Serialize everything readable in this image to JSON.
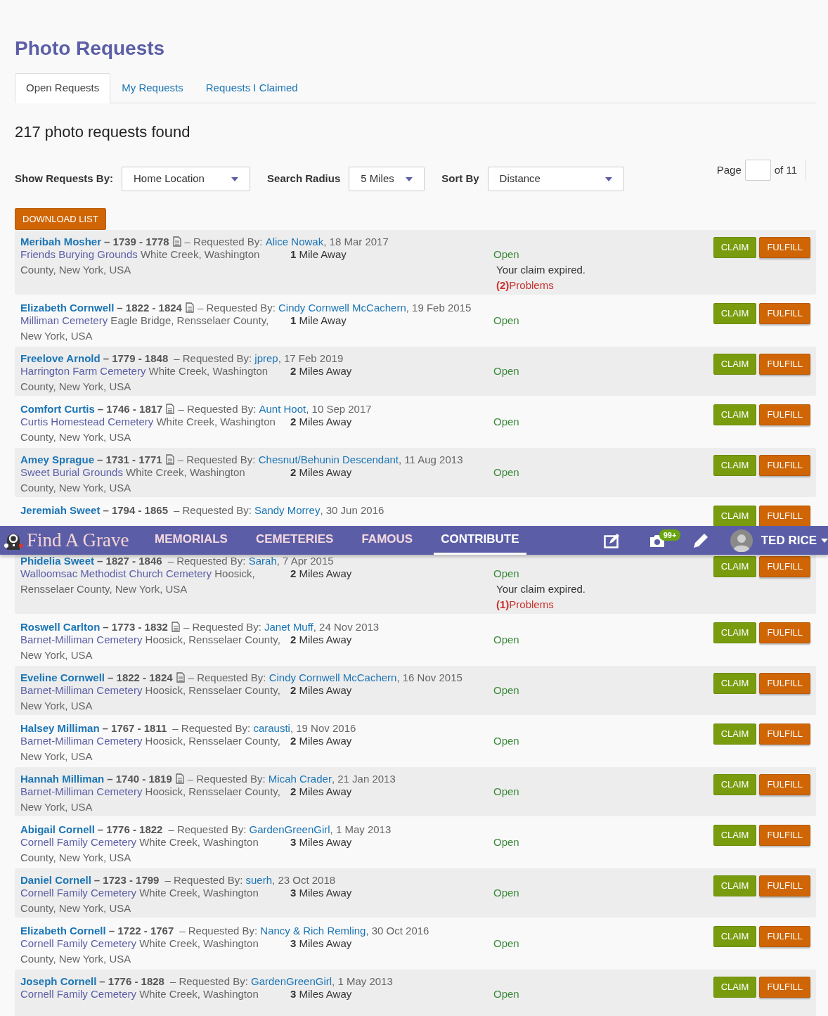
{
  "title": "Photo Requests",
  "tabs": [
    {
      "label": "Open Requests",
      "selected": true
    },
    {
      "label": "My Requests",
      "selected": false
    },
    {
      "label": "Requests I Claimed",
      "selected": false
    }
  ],
  "found": "217 photo requests found",
  "filters": [
    {
      "label": "Show Requests By:",
      "value": "Home Location"
    },
    {
      "label": "Search Radius",
      "value": "5 Miles"
    },
    {
      "label": "Sort By",
      "value": "Distance"
    }
  ],
  "pager": {
    "label": "Page",
    "total": "of 11"
  },
  "download": "DOWNLOAD LIST",
  "requests": [
    {
      "name": "Meribah Mosher",
      "years": "– 1739 - 1778",
      "note": true,
      "by": "– Requested By: ",
      "requester": "Alice Nowak",
      "date": ", 18 Mar 2017",
      "cemetery": "Friends Burying Grounds",
      "place": " White Creek, Washington County, New York, USA",
      "distance": "**1** Mile Away",
      "status": "Open",
      "expired": "Your claim expired.",
      "problems": "**(2)**Problems",
      "claim": "CLAIM",
      "fulfill": "FULFILL"
    },
    {
      "name": "Elizabeth Cornwell",
      "years": "– 1822 - 1824",
      "note": true,
      "by": "– Requested By: ",
      "requester": "Cindy Cornwell McCachern",
      "date": ", 19 Feb 2015",
      "cemetery": "Milliman Cemetery",
      "place": " Eagle Bridge, Rensselaer County, New York, USA",
      "distance": "**1** Mile Away",
      "status": "Open",
      "claim": "CLAIM",
      "fulfill": "FULFILL"
    },
    {
      "name": "Freelove Arnold",
      "years": "– 1779 - 1848",
      "note": false,
      "by": "– Requested By: ",
      "requester": "jprep",
      "date": ", 17 Feb 2019",
      "cemetery": "Harrington Farm Cemetery",
      "place": " White Creek, Washington County, New York, USA",
      "distance": "**2** Miles Away",
      "status": "Open",
      "claim": "CLAIM",
      "fulfill": "FULFILL"
    },
    {
      "name": "Comfort Curtis",
      "years": "– 1746 - 1817",
      "note": true,
      "by": "– Requested By: ",
      "requester": "Aunt Hoot",
      "date": ", 10 Sep 2017",
      "cemetery": "Curtis Homestead Cemetery",
      "place": " White Creek, Washington County, New York, USA",
      "distance": "**2** Miles Away",
      "status": "Open",
      "claim": "CLAIM",
      "fulfill": "FULFILL"
    },
    {
      "name": "Amey Sprague",
      "years": "– 1731 - 1771",
      "note": true,
      "by": "– Requested By: ",
      "requester": "Chesnut/Behunin Descendant",
      "date": ", 11 Aug 2013",
      "cemetery": "Sweet Burial Grounds",
      "place": " White Creek, Washington County, New York, USA",
      "distance": "**2** Miles Away",
      "status": "Open",
      "claim": "CLAIM",
      "fulfill": "FULFILL"
    },
    {
      "name": "Jeremiah Sweet",
      "years": "– 1794 - 1865",
      "note": false,
      "by": "– Requested By: ",
      "requester": "Sandy Morrey",
      "date": ", 30 Jun 2016",
      "claim": "CLAIM",
      "fulfill": "FULFILL"
    },
    {
      "name": "Phidelia Sweet",
      "years": "– 1827 - 1846",
      "note": false,
      "by": "– Requested By: ",
      "requester": "Sarah",
      "date": ", 7 Apr 2015",
      "cemetery": "Walloomsac Methodist Church Cemetery",
      "place": " Hoosick, Rensselaer County, New York, USA",
      "distance": "**2** Miles Away",
      "status": "Open",
      "expired": "Your claim expired.",
      "problems": "**(1)**Problems",
      "claim": "CLAIM",
      "fulfill": "FULFILL"
    },
    {
      "name": "Roswell Carlton",
      "years": "– 1773 - 1832",
      "note": true,
      "by": "– Requested By: ",
      "requester": "Janet Muff",
      "date": ", 24 Nov 2013",
      "cemetery": "Barnet-Milliman Cemetery",
      "place": " Hoosick, Rensselaer County, New York, USA",
      "distance": "**2** Miles Away",
      "status": "Open",
      "claim": "CLAIM",
      "fulfill": "FULFILL"
    },
    {
      "name": "Eveline Cornwell",
      "years": "– 1822 - 1824",
      "note": true,
      "by": "– Requested By: ",
      "requester": "Cindy Cornwell McCachern",
      "date": ", 16 Nov 2015",
      "cemetery": "Barnet-Milliman Cemetery",
      "place": " Hoosick, Rensselaer County, New York, USA",
      "distance": "**2** Miles Away",
      "status": "Open",
      "claim": "CLAIM",
      "fulfill": "FULFILL"
    },
    {
      "name": "Halsey Milliman",
      "years": "– 1767 - 1811",
      "note": false,
      "by": "– Requested By: ",
      "requester": "carausti",
      "date": ", 19 Nov 2016",
      "cemetery": "Barnet-Milliman Cemetery",
      "place": " Hoosick, Rensselaer County, New York, USA",
      "distance": "**2** Miles Away",
      "status": "Open",
      "claim": "CLAIM",
      "fulfill": "FULFILL"
    },
    {
      "name": "Hannah Milliman",
      "years": "– 1740 - 1819",
      "note": true,
      "by": "– Requested By: ",
      "requester": "Micah Crader",
      "date": ", 21 Jan 2013",
      "cemetery": "Barnet-Milliman Cemetery",
      "place": " Hoosick, Rensselaer County, New York, USA",
      "distance": "**2** Miles Away",
      "status": "Open",
      "claim": "CLAIM",
      "fulfill": "FULFILL"
    },
    {
      "name": "Abigail Cornell",
      "years": "– 1776 - 1822",
      "note": false,
      "by": "– Requested By: ",
      "requester": "GardenGreenGirl",
      "date": ", 1 May 2013",
      "cemetery": "Cornell Family Cemetery",
      "place": " White Creek, Washington County, New York, USA",
      "distance": "**3** Miles Away",
      "status": "Open",
      "claim": "CLAIM",
      "fulfill": "FULFILL"
    },
    {
      "name": "Daniel Cornell",
      "years": "– 1723 - 1799",
      "note": false,
      "by": "– Requested By: ",
      "requester": "suerh",
      "date": ", 23 Oct 2018",
      "cemetery": "Cornell Family Cemetery",
      "place": " White Creek, Washington County, New York, USA",
      "distance": "**3** Miles Away",
      "status": "Open",
      "claim": "CLAIM",
      "fulfill": "FULFILL"
    },
    {
      "name": "Elizabeth Cornell",
      "years": "– 1722 - 1767",
      "note": false,
      "by": "– Requested By: ",
      "requester": "Nancy & Rich Remling",
      "date": ", 30 Oct 2016",
      "cemetery": "Cornell Family Cemetery",
      "place": " White Creek, Washington County, New York, USA",
      "distance": "**3** Miles Away",
      "status": "Open",
      "claim": "CLAIM",
      "fulfill": "FULFILL"
    },
    {
      "name": "Joseph Cornell",
      "years": "– 1776 - 1828",
      "note": false,
      "by": "– Requested By: ",
      "requester": "GardenGreenGirl",
      "date": ", 1 May 2013",
      "cemetery": "Cornell Family Cemetery",
      "place": " White Creek, Washington",
      "distance": "**3** Miles Away",
      "status": "Open",
      "claim": "CLAIM",
      "fulfill": "FULFILL"
    }
  ],
  "navbar": {
    "logo": "Find A Grave",
    "items": [
      {
        "label": "MEMORIALS",
        "selected": false
      },
      {
        "label": "CEMETERIES",
        "selected": false
      },
      {
        "label": "FAMOUS",
        "selected": false
      },
      {
        "label": "CONTRIBUTE",
        "selected": true
      }
    ],
    "badge": "99+",
    "user": "TED RICE"
  }
}
